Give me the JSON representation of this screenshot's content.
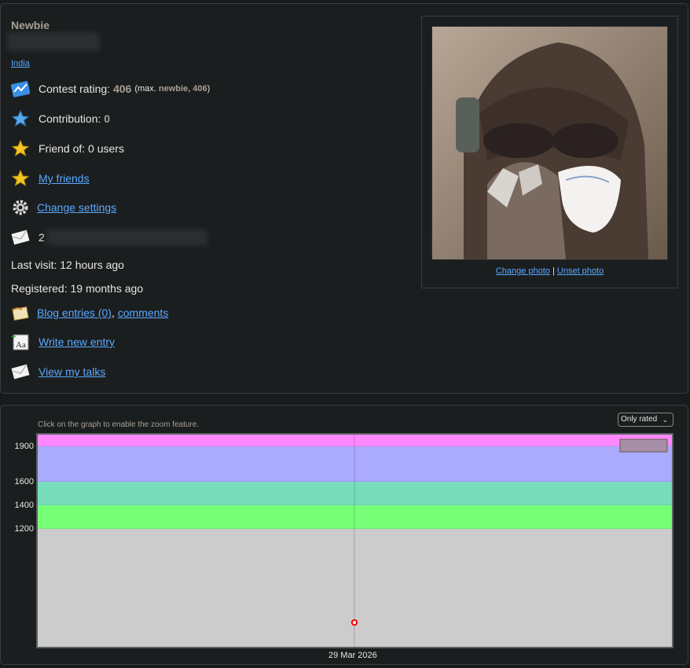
{
  "profile": {
    "rank": "Newbie",
    "country": "India",
    "contest_rating_label": "Contest rating:",
    "contest_rating_value": "406",
    "max_open": "(max.",
    "max_rank": "newbie, 406",
    "max_close": ")",
    "contribution_label": "Contribution:",
    "contribution_value": "0",
    "friend_of": "Friend of: 0 users",
    "my_friends": "My friends",
    "change_settings": "Change settings",
    "email_prefix": "2",
    "last_visit": "Last visit: 12 hours ago",
    "registered": "Registered: 19 months ago",
    "blog_entries": "Blog entries (0)",
    "comma": ",",
    "comments": "comments",
    "write_new_entry": "Write new entry",
    "view_my_talks": "View my talks"
  },
  "photo": {
    "change_photo": "Change photo",
    "separator": "|",
    "unset_photo": "Unset photo"
  },
  "graph": {
    "zoom_hint": "Click on the graph to enable the zoom feature.",
    "filter_selected": "Only rated",
    "colors": {
      "pink": "#ff88ff",
      "violet": "#aaaaff",
      "cyan": "#77ddbb",
      "green": "#77ff77",
      "gray": "#cccccc",
      "point": "#ff0000"
    }
  },
  "chart_data": {
    "type": "line",
    "x_tick_labels": [
      "29 Mar 2026"
    ],
    "y_tick_labels": [
      "1900",
      "1600",
      "1400",
      "1200"
    ],
    "ylim": [
      200,
      2000
    ],
    "bands": [
      {
        "from": 1900,
        "to": 2000,
        "color": "#ff88ff"
      },
      {
        "from": 1600,
        "to": 1900,
        "color": "#aaaaff"
      },
      {
        "from": 1400,
        "to": 1600,
        "color": "#77ddbb"
      },
      {
        "from": 1200,
        "to": 1400,
        "color": "#77ff77"
      },
      {
        "from": 200,
        "to": 1200,
        "color": "#cccccc"
      }
    ],
    "series": [
      {
        "values": [
          {
            "x": "29 Mar 2026",
            "y": 406
          }
        ]
      }
    ],
    "legend": "top-right",
    "grid": true
  }
}
